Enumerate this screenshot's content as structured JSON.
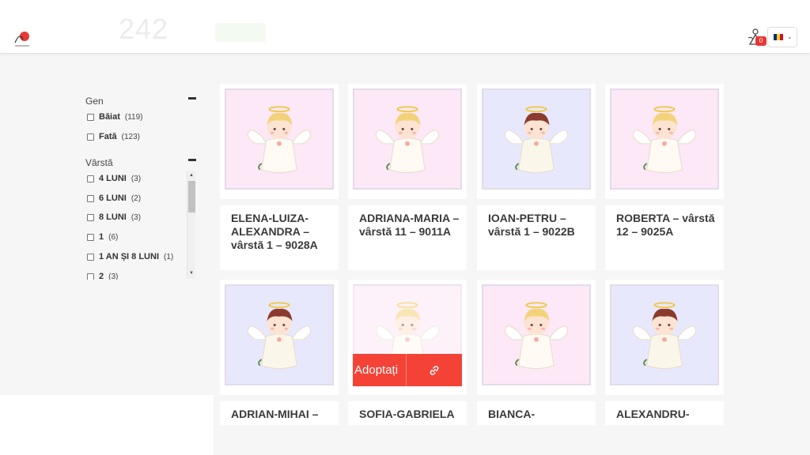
{
  "header": {
    "count": "242",
    "cart_count": "0",
    "flag_colors": [
      "#002B7F",
      "#FCD116",
      "#CE1126"
    ]
  },
  "filters": {
    "gender": {
      "title": "Gen",
      "options": [
        {
          "label": "Băiat",
          "count": "(119)"
        },
        {
          "label": "Fată",
          "count": "(123)"
        }
      ]
    },
    "age": {
      "title": "Vârstă",
      "options": [
        {
          "label": "4 LUNI",
          "count": "(3)"
        },
        {
          "label": "6 LUNI",
          "count": "(2)"
        },
        {
          "label": "8 LUNI",
          "count": "(3)"
        },
        {
          "label": "1",
          "count": "(6)"
        },
        {
          "label": "1 AN ȘI 8 LUNI",
          "count": "(1)"
        },
        {
          "label": "2",
          "count": "(3)"
        }
      ]
    }
  },
  "cards": [
    {
      "title": "ELENA-LUIZA-ALEXANDRA – vârstă 1 – 9028A",
      "angel": "girl"
    },
    {
      "title": "ADRIANA-MARIA – vârstă 11 – 9011A",
      "angel": "girl"
    },
    {
      "title": "IOAN-PETRU – vârstă 1 – 9022B",
      "angel": "boy"
    },
    {
      "title": "ROBERTA – vârstă 12 – 9025A",
      "angel": "girl"
    },
    {
      "title": "ADRIAN-MIHAI –",
      "angel": "boy"
    },
    {
      "title": "SOFIA-GABRIELA",
      "angel": "girl"
    },
    {
      "title": "BIANCA-",
      "angel": "girl"
    },
    {
      "title": "ALEXANDRU-",
      "angel": "boy"
    }
  ],
  "adopt": {
    "label": "Adoptați"
  },
  "colors": {
    "accent": "#f44336",
    "girl_bg": "#fce8f6",
    "boy_bg": "#e8e8fc"
  }
}
